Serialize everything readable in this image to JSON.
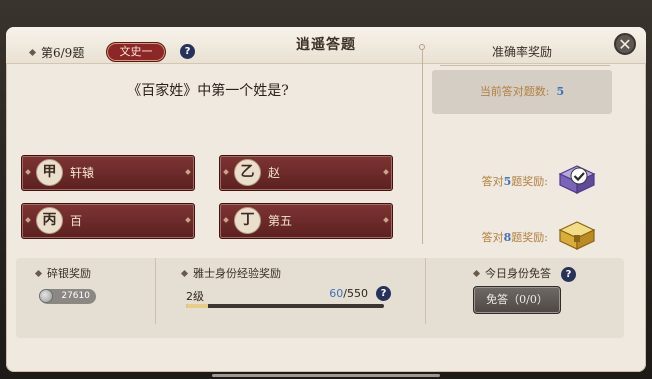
{
  "dialog": {
    "title": "逍遥答题",
    "close_glyph": "✕"
  },
  "question": {
    "progress": "第6/9题",
    "category": "文史一",
    "text": "《百家姓》中第一个姓是?",
    "help_glyph": "?"
  },
  "answers": [
    {
      "seal": "甲",
      "label": "轩辕"
    },
    {
      "seal": "乙",
      "label": "赵"
    },
    {
      "seal": "丙",
      "label": "百"
    },
    {
      "seal": "丁",
      "label": "第五"
    }
  ],
  "accuracy": {
    "title": "准确率奖励",
    "current_label": "当前答对题数:",
    "current_value": "5",
    "rewards": [
      {
        "prefix": "答对",
        "count": "5",
        "suffix": "题奖励:",
        "chest": "purple-chest-claimed"
      },
      {
        "prefix": "答对",
        "count": "8",
        "suffix": "题奖励:",
        "chest": "gold-chest"
      }
    ]
  },
  "bottom": {
    "silver_title": "碎银奖励",
    "silver_amount": "27610",
    "exp_title": "雅士身份经验奖励",
    "level": "2级",
    "exp_current": "60",
    "exp_total": "/550",
    "exp_fraction": 0.109,
    "exempt_title": "今日身份免答",
    "exempt_button": "免答（0/0）"
  },
  "colors": {
    "accent_red": "#8d2626",
    "highlight_blue": "#3f72b8",
    "reward_gold": "#b3803f"
  }
}
